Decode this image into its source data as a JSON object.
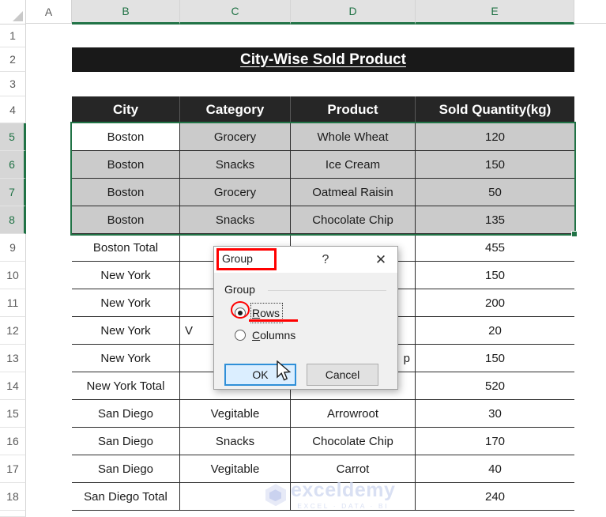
{
  "app": {
    "kind": "spreadsheet"
  },
  "sheet": {
    "column_headers": [
      "A",
      "B",
      "C",
      "D",
      "E"
    ],
    "selected_columns": [
      "B",
      "C",
      "D",
      "E"
    ],
    "row_headers": [
      "1",
      "2",
      "3",
      "4",
      "5",
      "6",
      "7",
      "8",
      "9",
      "10",
      "11",
      "12",
      "13",
      "14",
      "15",
      "16",
      "17",
      "18"
    ],
    "selected_rows": [
      "5",
      "6",
      "7",
      "8"
    ],
    "title": "City-Wise Sold Product",
    "table_headers": [
      "City",
      "Category",
      "Product",
      "Sold Quantity(kg)"
    ],
    "rows": [
      {
        "row": "5",
        "city": "Boston",
        "category": "Grocery",
        "product": "Whole Wheat",
        "qty": "120",
        "kind": "data",
        "selected": true,
        "active": true
      },
      {
        "row": "6",
        "city": "Boston",
        "category": "Snacks",
        "product": "Ice Cream",
        "qty": "150",
        "kind": "data",
        "selected": true,
        "active": false
      },
      {
        "row": "7",
        "city": "Boston",
        "category": "Grocery",
        "product": "Oatmeal Raisin",
        "qty": "50",
        "kind": "data",
        "selected": true,
        "active": false
      },
      {
        "row": "8",
        "city": "Boston",
        "category": "Snacks",
        "product": "Chocolate Chip",
        "qty": "135",
        "kind": "data",
        "selected": true,
        "active": false
      },
      {
        "row": "9",
        "city": "Boston Total",
        "category": "",
        "product": "",
        "qty": "455",
        "kind": "total",
        "selected": false,
        "active": false
      },
      {
        "row": "10",
        "city": "New York",
        "category": "",
        "product": "",
        "qty": "150",
        "kind": "data",
        "selected": false,
        "active": false
      },
      {
        "row": "11",
        "city": "New York",
        "category": "",
        "product": "",
        "qty": "200",
        "kind": "data",
        "selected": false,
        "active": false
      },
      {
        "row": "12",
        "city": "New York",
        "category": "V",
        "product": "",
        "qty": "20",
        "kind": "data",
        "selected": false,
        "active": false
      },
      {
        "row": "13",
        "city": "New York",
        "category": "",
        "product": "p",
        "qty": "150",
        "kind": "data",
        "selected": false,
        "active": false
      },
      {
        "row": "14",
        "city": "New York Total",
        "category": "",
        "product": "",
        "qty": "520",
        "kind": "total",
        "selected": false,
        "active": false
      },
      {
        "row": "15",
        "city": "San Diego",
        "category": "Vegitable",
        "product": "Arrowroot",
        "qty": "30",
        "kind": "data",
        "selected": false,
        "active": false
      },
      {
        "row": "16",
        "city": "San Diego",
        "category": "Snacks",
        "product": "Chocolate Chip",
        "qty": "170",
        "kind": "data",
        "selected": false,
        "active": false
      },
      {
        "row": "17",
        "city": "San Diego",
        "category": "Vegitable",
        "product": "Carrot",
        "qty": "40",
        "kind": "data",
        "selected": false,
        "active": false
      },
      {
        "row": "18",
        "city": "San Diego Total",
        "category": "",
        "product": "",
        "qty": "240",
        "kind": "total",
        "selected": false,
        "active": false
      }
    ]
  },
  "dialog": {
    "title": "Group",
    "help_icon": "?",
    "close_icon": "✕",
    "group_section_label": "Group",
    "options": [
      {
        "label": "Rows",
        "accel": "R",
        "selected": true,
        "focused": true
      },
      {
        "label": "Columns",
        "accel": "C",
        "selected": false,
        "focused": false
      }
    ],
    "ok_label": "OK",
    "cancel_label": "Cancel"
  },
  "annotations": {
    "title_highlight_color": "#ff0000",
    "rows_underline_color": "#ff0000",
    "radio_circle_color": "#ff0000"
  },
  "watermark": {
    "name": "exceldemy",
    "tagline": "EXCEL · DATA · BI"
  },
  "colors": {
    "accent_green": "#217346",
    "header_black": "#262626",
    "selection_fill": "#cbcbcb"
  }
}
